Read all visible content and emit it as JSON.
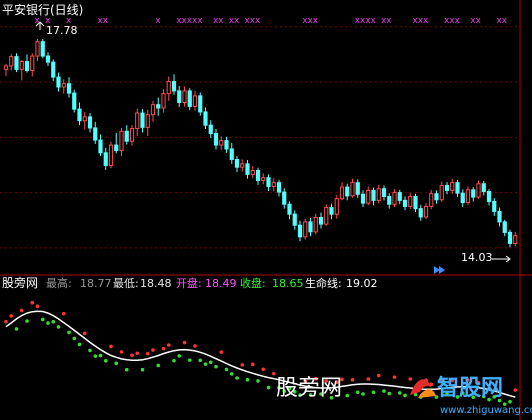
{
  "chart_data": [
    {
      "type": "candlestick",
      "title": "平安银行(日线)",
      "y_ticks": [
        18.0,
        17.0,
        16.0,
        15.0,
        14.0
      ],
      "ylim": [
        13.6,
        18.05
      ],
      "annotations": {
        "high_label": "17.78",
        "low_label": "14.03"
      },
      "signal_marks": "x",
      "candles": [
        [
          17.23,
          17.33,
          17.11,
          17.29
        ],
        [
          17.29,
          17.51,
          17.21,
          17.46
        ],
        [
          17.46,
          17.52,
          17.18,
          17.23
        ],
        [
          17.23,
          17.4,
          17.03,
          17.37
        ],
        [
          17.37,
          17.5,
          17.17,
          17.21
        ],
        [
          17.21,
          17.52,
          17.1,
          17.47
        ],
        [
          17.47,
          17.78,
          17.38,
          17.73
        ],
        [
          17.73,
          17.78,
          17.43,
          17.47
        ],
        [
          17.47,
          17.54,
          17.29,
          17.36
        ],
        [
          17.36,
          17.41,
          17.02,
          17.09
        ],
        [
          17.09,
          17.17,
          16.83,
          16.91
        ],
        [
          16.91,
          17.05,
          16.79,
          16.97
        ],
        [
          16.97,
          17.09,
          16.72,
          16.8
        ],
        [
          16.8,
          16.86,
          16.45,
          16.51
        ],
        [
          16.51,
          16.63,
          16.22,
          16.3
        ],
        [
          16.3,
          16.46,
          16.14,
          16.37
        ],
        [
          16.37,
          16.44,
          16.09,
          16.17
        ],
        [
          16.17,
          16.28,
          15.88,
          15.95
        ],
        [
          15.95,
          16.05,
          15.66,
          15.72
        ],
        [
          15.72,
          15.81,
          15.41,
          15.49
        ],
        [
          15.49,
          15.92,
          15.44,
          15.86
        ],
        [
          15.86,
          16.08,
          15.71,
          15.76
        ],
        [
          15.76,
          16.17,
          15.66,
          16.11
        ],
        [
          16.11,
          16.22,
          15.87,
          15.93
        ],
        [
          15.93,
          16.22,
          15.85,
          16.16
        ],
        [
          16.16,
          16.52,
          16.02,
          16.44
        ],
        [
          16.44,
          16.51,
          16.09,
          16.18
        ],
        [
          16.18,
          16.5,
          16.02,
          16.41
        ],
        [
          16.41,
          16.66,
          16.28,
          16.59
        ],
        [
          16.59,
          16.72,
          16.39,
          16.53
        ],
        [
          16.53,
          16.87,
          16.45,
          16.79
        ],
        [
          16.79,
          17.1,
          16.66,
          17.01
        ],
        [
          17.01,
          17.14,
          16.77,
          16.84
        ],
        [
          16.84,
          16.93,
          16.55,
          16.63
        ],
        [
          16.63,
          16.92,
          16.56,
          16.84
        ],
        [
          16.84,
          16.89,
          16.49,
          16.56
        ],
        [
          16.56,
          16.84,
          16.48,
          16.75
        ],
        [
          16.75,
          16.81,
          16.39,
          16.46
        ],
        [
          16.46,
          16.54,
          16.15,
          16.22
        ],
        [
          16.22,
          16.31,
          15.99,
          16.07
        ],
        [
          16.07,
          16.15,
          15.78,
          15.86
        ],
        [
          15.86,
          16.02,
          15.77,
          15.94
        ],
        [
          15.94,
          16.01,
          15.72,
          15.79
        ],
        [
          15.79,
          15.9,
          15.52,
          15.6
        ],
        [
          15.6,
          15.66,
          15.37,
          15.46
        ],
        [
          15.46,
          15.6,
          15.38,
          15.52
        ],
        [
          15.52,
          15.59,
          15.25,
          15.33
        ],
        [
          15.33,
          15.48,
          15.26,
          15.4
        ],
        [
          15.4,
          15.45,
          15.14,
          15.22
        ],
        [
          15.22,
          15.35,
          15.15,
          15.27
        ],
        [
          15.27,
          15.33,
          15.03,
          15.11
        ],
        [
          15.11,
          15.26,
          15.02,
          15.18
        ],
        [
          15.18,
          15.23,
          14.93,
          15.01
        ],
        [
          15.01,
          15.08,
          14.71,
          14.79
        ],
        [
          14.79,
          14.84,
          14.52,
          14.61
        ],
        [
          14.61,
          14.68,
          14.33,
          14.41
        ],
        [
          14.41,
          14.49,
          14.12,
          14.2
        ],
        [
          14.2,
          14.53,
          14.15,
          14.47
        ],
        [
          14.47,
          14.54,
          14.21,
          14.29
        ],
        [
          14.29,
          14.62,
          14.24,
          14.55
        ],
        [
          14.55,
          14.64,
          14.35,
          14.43
        ],
        [
          14.43,
          14.79,
          14.4,
          14.73
        ],
        [
          14.73,
          14.8,
          14.52,
          14.61
        ],
        [
          14.61,
          14.95,
          14.53,
          14.89
        ],
        [
          14.89,
          15.19,
          14.86,
          15.1
        ],
        [
          15.1,
          15.16,
          14.86,
          14.94
        ],
        [
          14.94,
          15.25,
          14.91,
          15.18
        ],
        [
          15.18,
          15.24,
          14.9,
          14.97
        ],
        [
          14.97,
          15.04,
          14.74,
          14.81
        ],
        [
          14.81,
          15.11,
          14.77,
          15.04
        ],
        [
          15.04,
          15.09,
          14.77,
          14.86
        ],
        [
          14.86,
          15.14,
          14.81,
          15.07
        ],
        [
          15.07,
          15.13,
          14.86,
          14.93
        ],
        [
          14.93,
          14.99,
          14.71,
          14.79
        ],
        [
          14.79,
          15.06,
          14.74,
          15.0
        ],
        [
          15.0,
          15.05,
          14.79,
          14.86
        ],
        [
          14.86,
          14.93,
          14.68,
          14.75
        ],
        [
          14.75,
          14.99,
          14.7,
          14.93
        ],
        [
          14.93,
          14.98,
          14.65,
          14.71
        ],
        [
          14.71,
          14.78,
          14.49,
          14.56
        ],
        [
          14.56,
          14.81,
          14.52,
          14.75
        ],
        [
          14.75,
          15.05,
          14.7,
          14.98
        ],
        [
          14.98,
          15.04,
          14.8,
          14.87
        ],
        [
          14.87,
          15.2,
          14.83,
          15.13
        ],
        [
          15.13,
          15.19,
          14.97,
          15.04
        ],
        [
          15.04,
          15.25,
          14.98,
          15.18
        ],
        [
          15.18,
          15.23,
          14.92,
          14.99
        ],
        [
          14.99,
          15.06,
          14.74,
          14.82
        ],
        [
          14.82,
          15.11,
          14.78,
          15.05
        ],
        [
          15.05,
          15.1,
          14.84,
          14.92
        ],
        [
          14.92,
          15.22,
          14.89,
          15.16
        ],
        [
          15.16,
          15.21,
          14.95,
          15.02
        ],
        [
          15.02,
          15.06,
          14.77,
          14.84
        ],
        [
          14.84,
          14.9,
          14.58,
          14.66
        ],
        [
          14.66,
          14.73,
          14.39,
          14.47
        ],
        [
          14.47,
          14.51,
          14.21,
          14.28
        ],
        [
          14.28,
          14.33,
          14.01,
          14.08
        ],
        [
          14.08,
          14.29,
          14.03,
          14.22
        ]
      ]
    },
    {
      "type": "line",
      "title": "股旁网",
      "legend": [
        {
          "label": "最高:",
          "value": "18.77",
          "label_color": "#9a9a9a",
          "value_color": "#9a9a9a"
        },
        {
          "label": "最低:",
          "value": "18.48",
          "label_color": "#e8e8e8",
          "value_color": "#e8e8e8"
        },
        {
          "label": "开盘:",
          "value": "18.49",
          "label_color": "#ff55ff",
          "value_color": "#ff55ff"
        },
        {
          "label": "收盘:",
          "value": "18.65",
          "label_color": "#33ee33",
          "value_color": "#33ee33"
        },
        {
          "label": "生命线:",
          "value": "19.02",
          "label_color": "#ffffff",
          "value_color": "#ffffff"
        }
      ],
      "ylim": [
        13.6,
        18.4
      ],
      "series": [
        {
          "name": "生命线",
          "values": [
            17.1,
            17.24,
            17.39,
            17.52,
            17.61,
            17.66,
            17.68,
            17.67,
            17.61,
            17.51,
            17.39,
            17.25,
            17.11,
            16.96,
            16.81,
            16.66,
            16.51,
            16.37,
            16.24,
            16.12,
            16.02,
            15.95,
            15.89,
            15.86,
            15.84,
            15.84,
            15.86,
            15.9,
            15.96,
            16.02,
            16.09,
            16.15,
            16.2,
            16.23,
            16.24,
            16.22,
            16.19,
            16.14,
            16.07,
            15.99,
            15.9,
            15.81,
            15.72,
            15.63,
            15.55,
            15.48,
            15.41,
            15.35,
            15.29,
            15.24,
            15.19,
            15.15,
            15.11,
            15.06,
            15.01,
            14.96,
            14.91,
            14.87,
            14.84,
            14.81,
            14.8,
            14.8,
            14.81,
            14.83,
            14.86,
            14.89,
            14.92,
            14.94,
            14.95,
            14.95,
            14.94,
            14.93,
            14.91,
            14.89,
            14.87,
            14.84,
            14.82,
            14.8,
            14.78,
            14.76,
            14.75,
            14.75,
            14.76,
            14.78,
            14.8,
            14.82,
            14.84,
            14.84,
            14.84,
            14.83,
            14.81,
            14.78,
            14.74,
            14.69,
            14.63,
            14.57,
            14.51,
            14.46
          ]
        }
      ]
    }
  ],
  "watermark": {
    "text1": "股旁网",
    "text2": "智股网",
    "url": "www.zhiguwang.com"
  }
}
